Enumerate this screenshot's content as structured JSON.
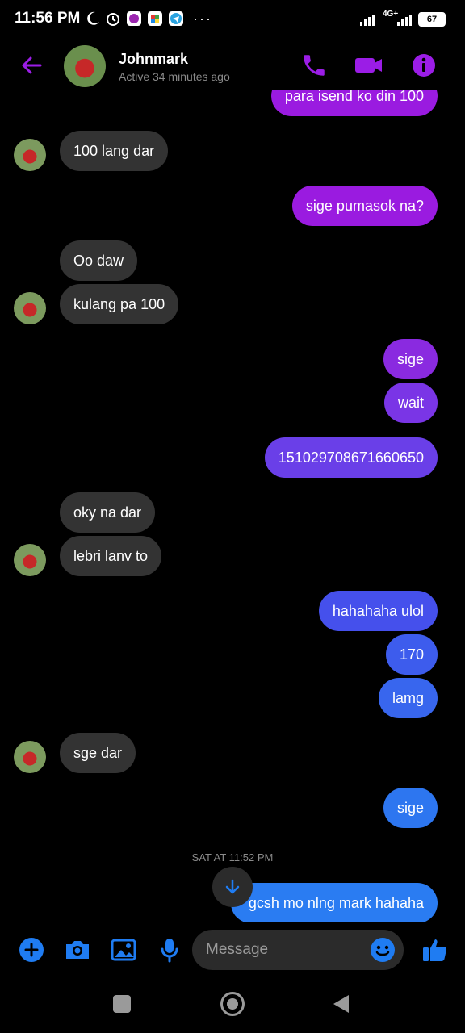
{
  "status": {
    "time": "11:56 PM",
    "network": "4G+",
    "battery": "67"
  },
  "header": {
    "name": "Johnmark",
    "active": "Active 34 minutes ago"
  },
  "messages": [
    {
      "side": "out",
      "text": "para isend ko din 100",
      "color": "#9a1be0"
    },
    {
      "side": "in",
      "text": "100 lang dar"
    },
    {
      "side": "out",
      "text": "sige pumasok na?",
      "color": "#9a1be0"
    },
    {
      "side": "in",
      "text": "Oo daw"
    },
    {
      "side": "in",
      "text": "kulang pa 100"
    },
    {
      "side": "out",
      "text": "sige",
      "color": "#8a2ae0"
    },
    {
      "side": "out",
      "text": "wait",
      "color": "#7a35e6"
    },
    {
      "side": "out",
      "text": "151029708671660650",
      "color": "#6a3fe8"
    },
    {
      "side": "in",
      "text": "oky na dar"
    },
    {
      "side": "in",
      "text": "lebri lanv to"
    },
    {
      "side": "out",
      "text": "hahahaha ulol",
      "color": "#4550ec"
    },
    {
      "side": "out",
      "text": "170",
      "color": "#3d5ced"
    },
    {
      "side": "out",
      "text": "lamg",
      "color": "#3866ee"
    },
    {
      "side": "in",
      "text": "sge dar"
    },
    {
      "side": "out",
      "text": "sige",
      "color": "#2d76f0"
    },
    {
      "side": "out",
      "text": "gcsh mo nlng mark hahaha",
      "color": "#2a7cf2"
    }
  ],
  "timestamp": "SAT AT 11:52 PM",
  "composer": {
    "placeholder": "Message"
  },
  "colors": {
    "accent": "#9b1de6",
    "blue": "#1f7cf2"
  }
}
